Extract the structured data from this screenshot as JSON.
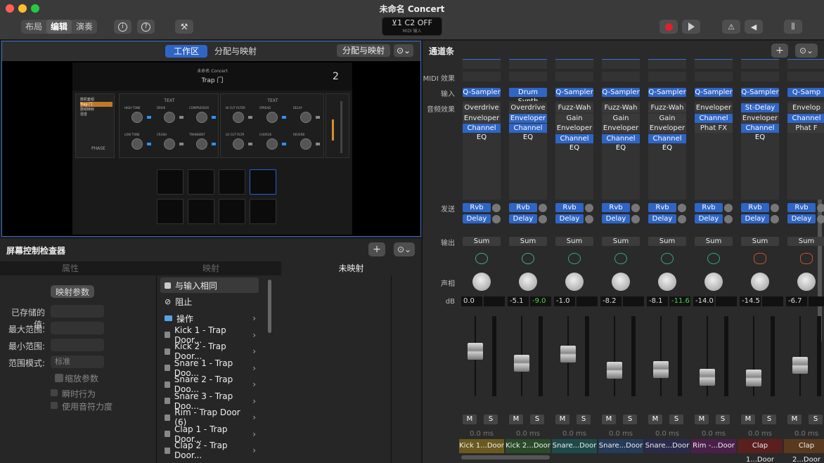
{
  "window": {
    "title": "未命名 Concert"
  },
  "toolbar": {
    "layout": "布局",
    "edit": "编辑",
    "perform": "演奏",
    "lcd_line1": "⊻1  C2  OFF",
    "lcd_line2": "MIDI 输入"
  },
  "panel": {
    "workspace_tab": "工作区",
    "assign_tab": "分配与映射",
    "assign_button": "分配与映射",
    "more": "⊙⌄",
    "patch_name": "未命名 Concert",
    "patch_sub": "Trap 门",
    "patch_number": "2",
    "mini_text_label_1": "TEXT",
    "mini_text_label_2": "TEXT",
    "mini_list": [
      "鼓机套组",
      "Trap 门",
      "鼓组映射",
      "混音"
    ],
    "mini_knobs": [
      "HIGH TONE",
      "DRIVE",
      "COMPRESSOR",
      "HI CUT FILTER",
      "SPREAD",
      "DELAY",
      "LOW TONE",
      "CRUSH",
      "TRANSIENT",
      "LO CUT FILTR",
      "CHORUS",
      "REVERB"
    ],
    "mini_small": "PHASE"
  },
  "inspector": {
    "title": "屏幕控制检查器",
    "add": "+",
    "more": "⊙⌄",
    "tab_attr": "属性",
    "tab_map": "映射",
    "tab_unmapped": "未映射",
    "map_params": "映射参数",
    "saved_value": "已存储的值:",
    "max_range": "最大范围:",
    "min_range": "最小范围:",
    "range_mode": "范围模式:",
    "range_mode_value": "标准",
    "scale_params": "缩放参数",
    "momentary": "瞬时行为",
    "use_velocity": "使用音符力度",
    "list": [
      {
        "label": "与输入相同",
        "icon": "square-check-icon"
      },
      {
        "label": "阻止",
        "icon": "block-icon"
      },
      {
        "label": "操作",
        "icon": "folder-icon"
      },
      {
        "label": "Kick 1 - Trap Door..."
      },
      {
        "label": "Kick 2 - Trap Door..."
      },
      {
        "label": "Snare 1 - Trap Doo..."
      },
      {
        "label": "Snare 2 - Trap Doo..."
      },
      {
        "label": "Snare 3 - Trap Doo..."
      },
      {
        "label": "Rim - Trap Door (6)"
      },
      {
        "label": "Clap 1 - Trap Door..."
      },
      {
        "label": "Clap 2 - Trap Door..."
      }
    ]
  },
  "strips": {
    "title": "通道条",
    "add": "+",
    "more": "⊙⌄",
    "row_labels": {
      "midi": "MIDI 效果",
      "input": "输入",
      "audio": "音频效果",
      "send": "发送",
      "output": "输出",
      "pan": "声相",
      "db": "dB"
    },
    "channels": [
      {
        "instrument": "Q-Sampler",
        "fx": [
          "Overdrive",
          "Enveloper",
          "Channel EQ"
        ],
        "fxblue": [
          false,
          false,
          true
        ],
        "sends": [
          "Rvb",
          "Delay"
        ],
        "out": "Sum",
        "db": "0.0",
        "peak": "",
        "name": "Kick 1...Door",
        "color": "#6b5a1f",
        "icon": "tom-icon",
        "fader": 0.62,
        "mute": "M",
        "solo": "S",
        "ms": "0.0 ms"
      },
      {
        "instrument": "Drum Synth",
        "fx": [
          "Overdrive",
          "Enveloper",
          "Channel EQ"
        ],
        "fxblue": [
          false,
          true,
          true
        ],
        "sends": [
          "Rvb",
          "Delay"
        ],
        "out": "Sum",
        "db": "-5.1",
        "peak": "-9.0",
        "name": "Kick 2...Door",
        "color": "#2a4a2a",
        "icon": "tom-icon",
        "fader": 0.45,
        "mute": "M",
        "solo": "S",
        "ms": "0.0 ms"
      },
      {
        "instrument": "Q-Sampler",
        "fx": [
          "Fuzz-Wah",
          "Gain",
          "Enveloper",
          "Channel EQ"
        ],
        "fxblue": [
          false,
          false,
          false,
          true
        ],
        "sends": [
          "Rvb",
          "Delay"
        ],
        "out": "Sum",
        "db": "-1.0",
        "peak": "",
        "name": "Snare...Door",
        "color": "#1f4a4a",
        "icon": "drum-icon",
        "fader": 0.58,
        "mute": "M",
        "solo": "S",
        "ms": "0.0 ms"
      },
      {
        "instrument": "Q-Sampler",
        "fx": [
          "Fuzz-Wah",
          "Gain",
          "Enveloper",
          "Channel EQ"
        ],
        "fxblue": [
          false,
          false,
          false,
          true
        ],
        "sends": [
          "Rvb",
          "Delay"
        ],
        "out": "Sum",
        "db": "-8.2",
        "peak": "",
        "name": "Snare...Door",
        "color": "#263a5a",
        "icon": "drum-icon",
        "fader": 0.35,
        "mute": "M",
        "solo": "S",
        "ms": "0.0 ms"
      },
      {
        "instrument": "Q-Sampler",
        "fx": [
          "Fuzz-Wah",
          "Gain",
          "Enveloper",
          "Channel EQ"
        ],
        "fxblue": [
          false,
          false,
          false,
          true
        ],
        "sends": [
          "Rvb",
          "Delay"
        ],
        "out": "Sum",
        "db": "-8.1",
        "peak": "-11.6",
        "name": "Snare...Door",
        "color": "#2a2a4a",
        "icon": "drum-icon",
        "fader": 0.36,
        "mute": "M",
        "solo": "S",
        "ms": "0.0 ms"
      },
      {
        "instrument": "Q-Sampler",
        "fx": [
          "Enveloper",
          "Channel EQ",
          "Phat FX"
        ],
        "fxblue": [
          false,
          true,
          false
        ],
        "sends": [
          "Rvb",
          "Delay"
        ],
        "out": "Sum",
        "db": "-14.0",
        "peak": "",
        "name": "Rim -...Door",
        "color": "#4a1f4a",
        "icon": "drum-icon",
        "fader": 0.25,
        "mute": "M",
        "solo": "S",
        "ms": "0.0 ms"
      },
      {
        "instrument": "Q-Sampler",
        "fx": [
          "St-Delay",
          "Enveloper",
          "Channel EQ"
        ],
        "fxblue": [
          true,
          false,
          true
        ],
        "sends": [
          "Rvb",
          "Delay"
        ],
        "out": "Sum",
        "db": "-14.5",
        "peak": "",
        "name": "Clap 1...Door",
        "color": "#5a1f1f",
        "icon": "hand-icon",
        "fader": 0.24,
        "mute": "M",
        "solo": "S",
        "ms": "0.0 ms"
      },
      {
        "instrument": "Q-Samp",
        "fx": [
          "Envelop",
          "Channel",
          "Phat F"
        ],
        "fxblue": [
          false,
          true,
          false
        ],
        "sends": [
          "Rvb",
          "Delay"
        ],
        "out": "Sum",
        "db": "-6.7",
        "peak": "",
        "name": "Clap 2...Door",
        "color": "#5a3a1f",
        "icon": "hand-icon",
        "fader": 0.42,
        "mute": "M",
        "solo": "S",
        "ms": "0.0 ms"
      }
    ],
    "scale": [
      "6",
      "3",
      "0",
      "3",
      "6",
      "10",
      "15",
      "20",
      "30",
      "40",
      "60"
    ],
    "meter_scale": [
      "0",
      "3",
      "6",
      "9",
      "12",
      "15",
      "18",
      "21",
      "24",
      "30",
      "35",
      "40",
      "45",
      "50",
      "60"
    ]
  },
  "colors": {
    "accent": "#2f65c5",
    "selected_outline": "#3c6fc9",
    "record": "#e0202a"
  }
}
